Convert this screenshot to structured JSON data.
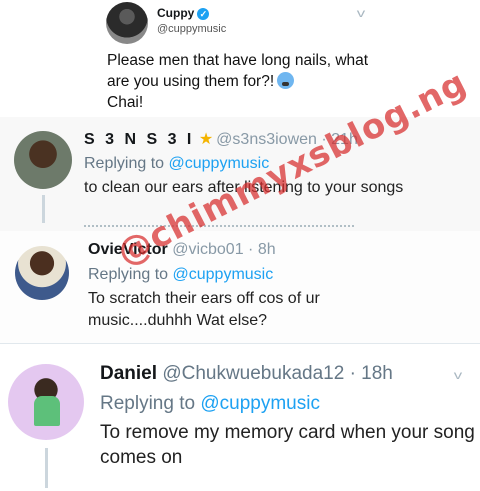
{
  "original_tweet": {
    "name": "Cuppy",
    "handle": "@cuppymusic",
    "verified_icon": "verified-badge-icon",
    "text": "Please men that have long nails, what are you using them for?!",
    "emoji": "weary-face-icon",
    "text_end": "Chai!"
  },
  "replies": [
    {
      "name": "S 3 N S 3 I",
      "badge_icon": "star-icon",
      "handle": "@s3ns3iowen",
      "time": "21h",
      "replying_label": "Replying to",
      "replying_to": "@cuppymusic",
      "text": "to clean our ears after listening to your songs"
    },
    {
      "name": "OvieVictor",
      "handle": "@vicbo01",
      "time": "8h",
      "replying_label": "Replying to",
      "replying_to": "@cuppymusic",
      "text": "To scratch their ears off cos of ur music....duhhh Wat else?"
    },
    {
      "name": "Daniel",
      "handle": "@Chukwuebukada12",
      "time": "18h",
      "replying_label": "Replying to",
      "replying_to": "@cuppymusic",
      "text": "To remove my memory card when your song comes on"
    }
  ],
  "separator": "·",
  "watermark": "@chimmyxsblog.ng",
  "colors": {
    "link": "#1da1f2",
    "watermark": "#d72d2d",
    "verified": "#1da1f2"
  }
}
